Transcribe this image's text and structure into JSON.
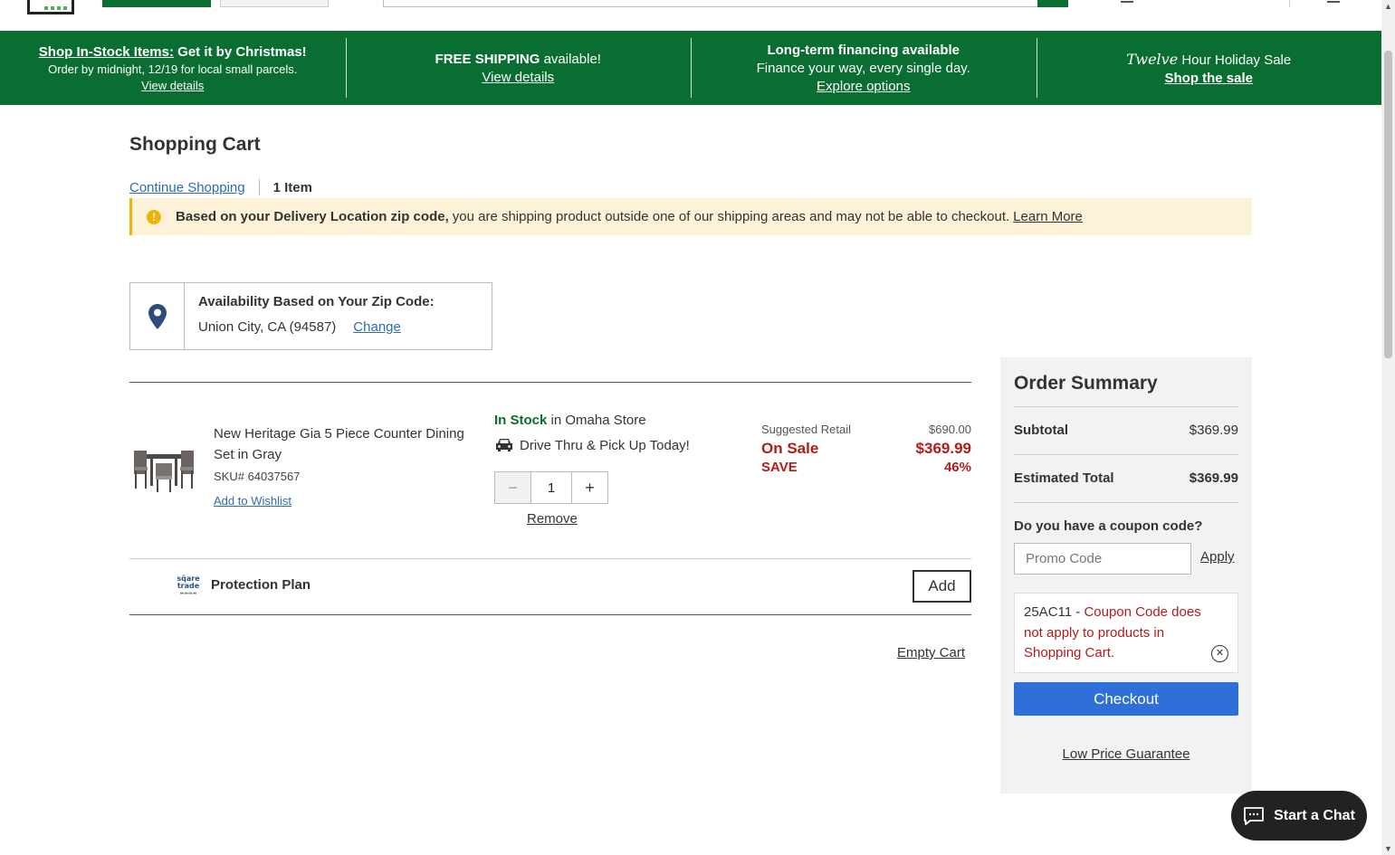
{
  "promo_banner": {
    "cell1": {
      "headline_link": "Shop In-Stock Items:",
      "headline_rest": " Get it by Christmas!",
      "subtext": "Order by midnight, 12/19 for local small parcels.",
      "link": "View details"
    },
    "cell2": {
      "headline_bold": "FREE SHIPPING",
      "headline_rest": " available!",
      "link": "View details"
    },
    "cell3": {
      "headline": "Long-term financing available",
      "subtext": "Finance your way, every single day.",
      "link": "Explore options"
    },
    "cell4": {
      "script_word": "Twelve",
      "headline": " Hour Holiday Sale",
      "link": "Shop the sale"
    }
  },
  "page": {
    "title": "Shopping Cart",
    "continue_link": "Continue Shopping",
    "item_count": "1 Item"
  },
  "warning": {
    "bold": "Based on your Delivery Location zip code,",
    "text": "you are shipping product outside one of our shipping areas and may not be able to checkout.",
    "link": "Learn More"
  },
  "zip": {
    "title": "Availability Based on Your Zip Code:",
    "location": "Union City, CA (94587)",
    "change_link": "Change"
  },
  "cart_item": {
    "name": "New Heritage Gia 5 Piece Counter Dining Set in Gray",
    "sku": "SKU# 64037567",
    "wishlist_link": "Add to Wishlist",
    "stock_status": "In Stock",
    "stock_location": " in Omaha Store",
    "pickup_text": "Drive Thru & Pick Up Today!",
    "quantity": "1",
    "minus": "−",
    "plus": "+",
    "remove_link": "Remove",
    "suggested_label": "Suggested Retail",
    "suggested_price": "$690.00",
    "sale_label": "On Sale",
    "sale_price": "$369.99",
    "save_label": "SAVE",
    "save_percent": "46%"
  },
  "protection": {
    "logo_text": "square trade",
    "label": "Protection Plan",
    "add_button": "Add"
  },
  "empty_cart_link": "Empty Cart",
  "summary": {
    "title": "Order Summary",
    "subtotal_label": "Subtotal",
    "subtotal_value": "$369.99",
    "total_label": "Estimated Total",
    "total_value": "$369.99",
    "coupon_question": "Do you have a coupon code?",
    "promo_placeholder": "Promo Code",
    "apply_link": "Apply",
    "coupon_code": "25AC11 - ",
    "coupon_error": "Coupon Code does not apply to products in Shopping Cart.",
    "checkout_button": "Checkout",
    "low_price_link": "Low Price Guarantee"
  },
  "chat": {
    "label": "Start a Chat"
  },
  "colors": {
    "brand_green": "#0a6e32",
    "link_blue": "#2d6bb5",
    "sale_red": "#b31b1b",
    "checkout_blue": "#2f6fd8",
    "warning_bg": "#fdf2d8"
  },
  "icons": [
    "location-pin-icon",
    "warning-icon",
    "car-icon",
    "close-circle-icon",
    "chat-icon",
    "minus-icon",
    "plus-icon"
  ]
}
